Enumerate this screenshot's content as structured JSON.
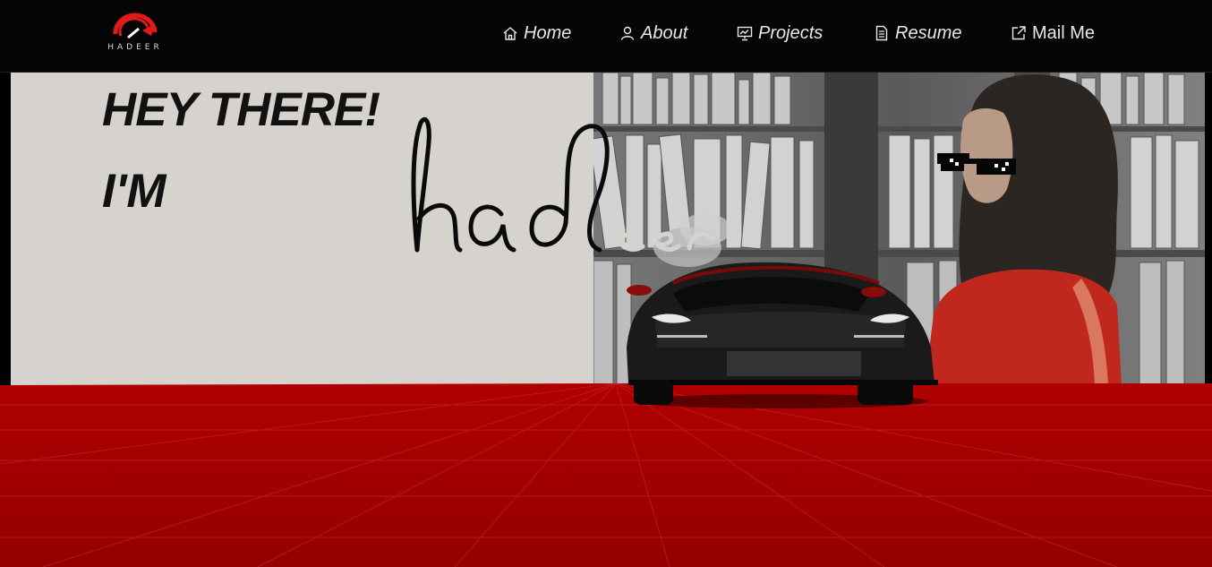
{
  "logo": {
    "text": "HADEER",
    "accent": "#e21a1a"
  },
  "nav": {
    "items": [
      {
        "label": "Home",
        "icon": "home-icon"
      },
      {
        "label": "About",
        "icon": "user-icon"
      },
      {
        "label": "Projects",
        "icon": "presentation-icon"
      },
      {
        "label": "Resume",
        "icon": "document-icon"
      },
      {
        "label": "Mail Me",
        "icon": "external-link-icon"
      }
    ]
  },
  "hero": {
    "greeting": "HEY THERE!",
    "intro": "I'M",
    "name_script": "hadeer",
    "colors": {
      "panel": "#d6d3cf",
      "floor": "#9a0000",
      "text": "#111111"
    }
  }
}
